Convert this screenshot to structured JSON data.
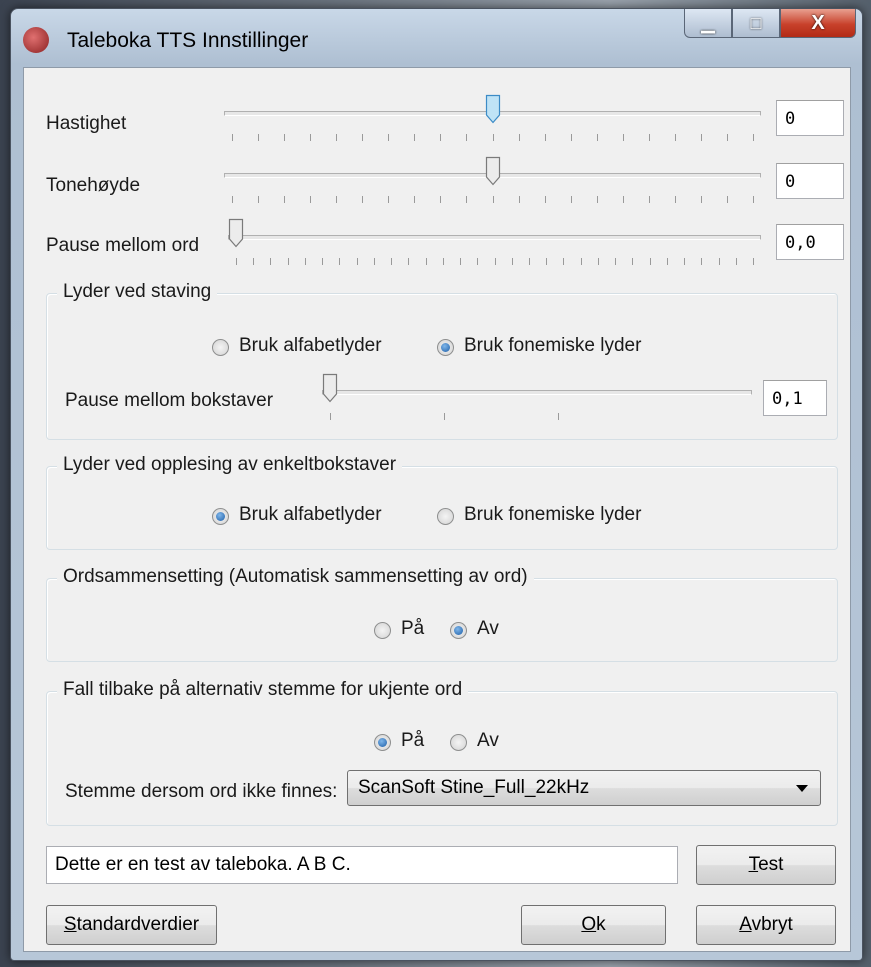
{
  "window": {
    "title": "Taleboka TTS Innstillinger",
    "minimize_glyph": "▁",
    "maximize_glyph": "□",
    "close_glyph": "X"
  },
  "sliders": {
    "speed": {
      "label": "Hastighet",
      "value": "0",
      "position": 0.5
    },
    "pitch": {
      "label": "Tonehøyde",
      "value": "0",
      "position": 0.5
    },
    "word_pause": {
      "label": "Pause mellom ord",
      "value": "0,0",
      "position": 0.0
    }
  },
  "spelling": {
    "group_label": "Lyder ved staving",
    "option_alphabet": "Bruk alfabetlyder",
    "option_phonemic": "Bruk fonemiske lyder",
    "selected": "phonemic",
    "letter_pause_label": "Pause mellom bokstaver",
    "letter_pause_value": "0,1",
    "letter_pause_position": 0.0
  },
  "single_letters": {
    "group_label": "Lyder ved opplesing av enkeltbokstaver",
    "option_alphabet": "Bruk alfabetlyder",
    "option_phonemic": "Bruk fonemiske lyder",
    "selected": "alphabet"
  },
  "compounding": {
    "group_label": "Ordsammensetting (Automatisk sammensetting av ord)",
    "option_on": "På",
    "option_off": "Av",
    "selected": "off"
  },
  "fallback": {
    "group_label": "Fall tilbake på alternativ stemme for ukjente ord",
    "option_on": "På",
    "option_off": "Av",
    "selected": "on",
    "voice_label": "Stemme dersom ord ikke finnes:",
    "voice_value": "ScanSoft Stine_Full_22kHz"
  },
  "test": {
    "text": "Dette er en test av taleboka. A B C.",
    "button_prefix": "",
    "button_accel": "T",
    "button_rest": "est"
  },
  "buttons": {
    "defaults_accel": "S",
    "defaults_rest": "tandardverdier",
    "ok_accel": "O",
    "ok_rest": "k",
    "cancel_accel": "A",
    "cancel_rest": "vbryt"
  }
}
